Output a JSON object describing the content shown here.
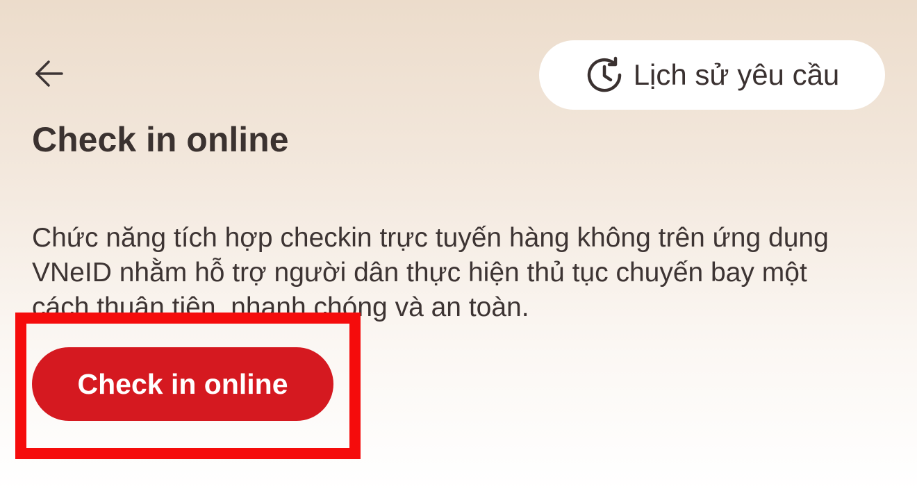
{
  "header": {
    "back_icon": "arrow-left-icon",
    "history_button": {
      "icon": "history-clock-icon",
      "label": "Lịch sử yêu cầu"
    }
  },
  "main": {
    "title": "Check in online",
    "description": "Chức năng tích hợp checkin trực tuyến hàng không trên ứng dụng VNeID nhằm hỗ trợ người dân thực hiện thủ tục chuyến bay một cách thuận tiện, nhanh chóng và an toàn.",
    "primary_button_label": "Check in online"
  },
  "colors": {
    "primary": "#d51920",
    "highlight": "#f50c0c",
    "text": "#3c3130",
    "background_top": "#ecdccb",
    "background_bottom": "#ffffff"
  }
}
